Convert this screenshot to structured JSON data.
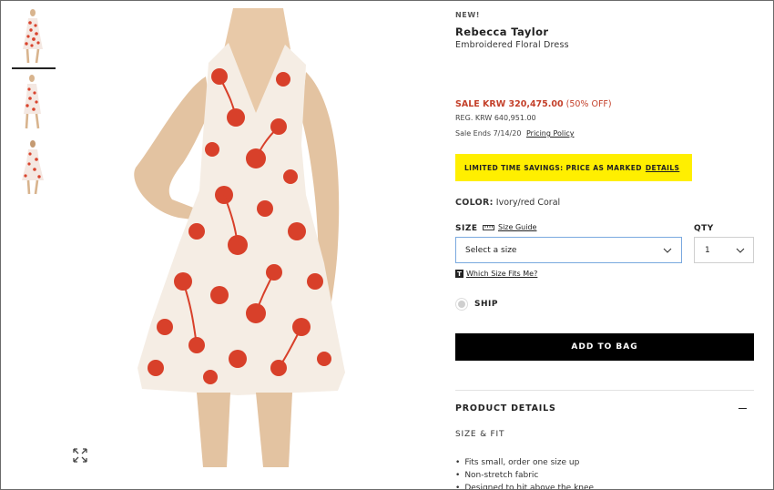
{
  "gallery": {
    "thumbnails": [
      {
        "alt": "",
        "selected": true
      },
      {
        "alt": "",
        "selected": false
      },
      {
        "alt": "",
        "selected": false
      }
    ],
    "expand_icon": "expand-arrows-icon"
  },
  "product": {
    "badge": "NEW!",
    "brand": "Rebecca Taylor",
    "name": "Embroidered Floral Dress",
    "sale_price_label": "SALE KRW 320,475.00",
    "discount": "(50% OFF)",
    "regular_price": "REG. KRW 640,951.00",
    "sale_ends": "Sale Ends 7/14/20",
    "pricing_policy_link": "Pricing Policy",
    "promo_text": "LIMITED TIME SAVINGS: PRICE AS MARKED",
    "promo_link": "DETAILS",
    "color_label": "COLOR:",
    "color_value": "Ivory/red Coral",
    "size_label": "SIZE",
    "size_guide_link": "Size Guide",
    "size_select_value": "Select a size",
    "qty_label": "QTY",
    "qty_value": "1",
    "fit_badge": "T",
    "fit_link": "Which Size Fits Me?",
    "ship_label": "SHIP",
    "add_to_bag": "ADD TO BAG",
    "details_title": "PRODUCT DETAILS",
    "size_fit_heading": "SIZE & FIT",
    "size_fit_bullets": [
      "Fits small, order one size up",
      "Non-stretch fabric",
      "Designed to hit above the knee"
    ]
  },
  "colors": {
    "sale": "#c4412b",
    "promo_bg": "#ffef00",
    "button_bg": "#000000",
    "select_focus": "#7aa9df"
  }
}
